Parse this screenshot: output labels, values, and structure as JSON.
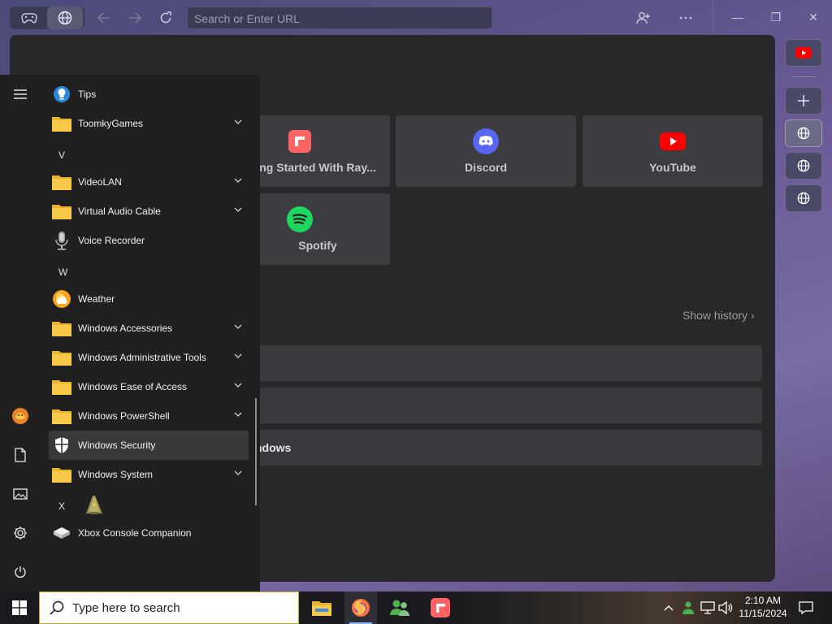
{
  "browser": {
    "url_placeholder": "Search or Enter URL",
    "window_buttons": {
      "minimize": "—",
      "maximize": "❐",
      "close": "✕"
    }
  },
  "speed_dial": {
    "tiles": [
      {
        "label": "ng Started With Ray...",
        "icon": "raycast-icon"
      },
      {
        "label": "Discord",
        "icon": "discord-icon"
      },
      {
        "label": "YouTube",
        "icon": "youtube-icon"
      },
      {
        "label": "Spotify",
        "icon": "spotify-icon"
      }
    ],
    "show_history": "Show history ›",
    "history_rows": [
      "",
      "",
      "ndows"
    ]
  },
  "start_menu": {
    "letters": [
      "V",
      "W",
      "X"
    ],
    "apps": [
      {
        "label": "Tips",
        "icon": "tips-icon",
        "expandable": false
      },
      {
        "label": "ToomkyGames",
        "icon": "folder-icon",
        "expandable": true
      },
      {
        "label": "VideoLAN",
        "icon": "folder-icon",
        "expandable": true
      },
      {
        "label": "Virtual Audio Cable",
        "icon": "folder-icon",
        "expandable": true
      },
      {
        "label": "Voice Recorder",
        "icon": "microphone-icon",
        "expandable": false
      },
      {
        "label": "Weather",
        "icon": "weather-icon",
        "expandable": false
      },
      {
        "label": "Windows Accessories",
        "icon": "folder-icon",
        "expandable": true
      },
      {
        "label": "Windows Administrative Tools",
        "icon": "folder-icon",
        "expandable": true
      },
      {
        "label": "Windows Ease of Access",
        "icon": "folder-icon",
        "expandable": true
      },
      {
        "label": "Windows PowerShell",
        "icon": "folder-icon",
        "expandable": true
      },
      {
        "label": "Windows Security",
        "icon": "shield-icon",
        "expandable": false,
        "highlighted": true
      },
      {
        "label": "Windows System",
        "icon": "folder-icon",
        "expandable": true
      },
      {
        "label": "",
        "icon": "app-icon",
        "expandable": false
      },
      {
        "label": "Xbox Console Companion",
        "icon": "xbox-console-icon",
        "expandable": false
      }
    ]
  },
  "taskbar": {
    "search_placeholder": "Type here to search",
    "clock_time": "2:10 AM",
    "clock_date": "11/15/2024"
  },
  "colors": {
    "youtube": "#ff0000",
    "discord": "#5865f2",
    "spotify": "#1ed760",
    "raycast": "#ff6363",
    "folder": "#f8c948",
    "start_menu_bg": "#202020"
  }
}
